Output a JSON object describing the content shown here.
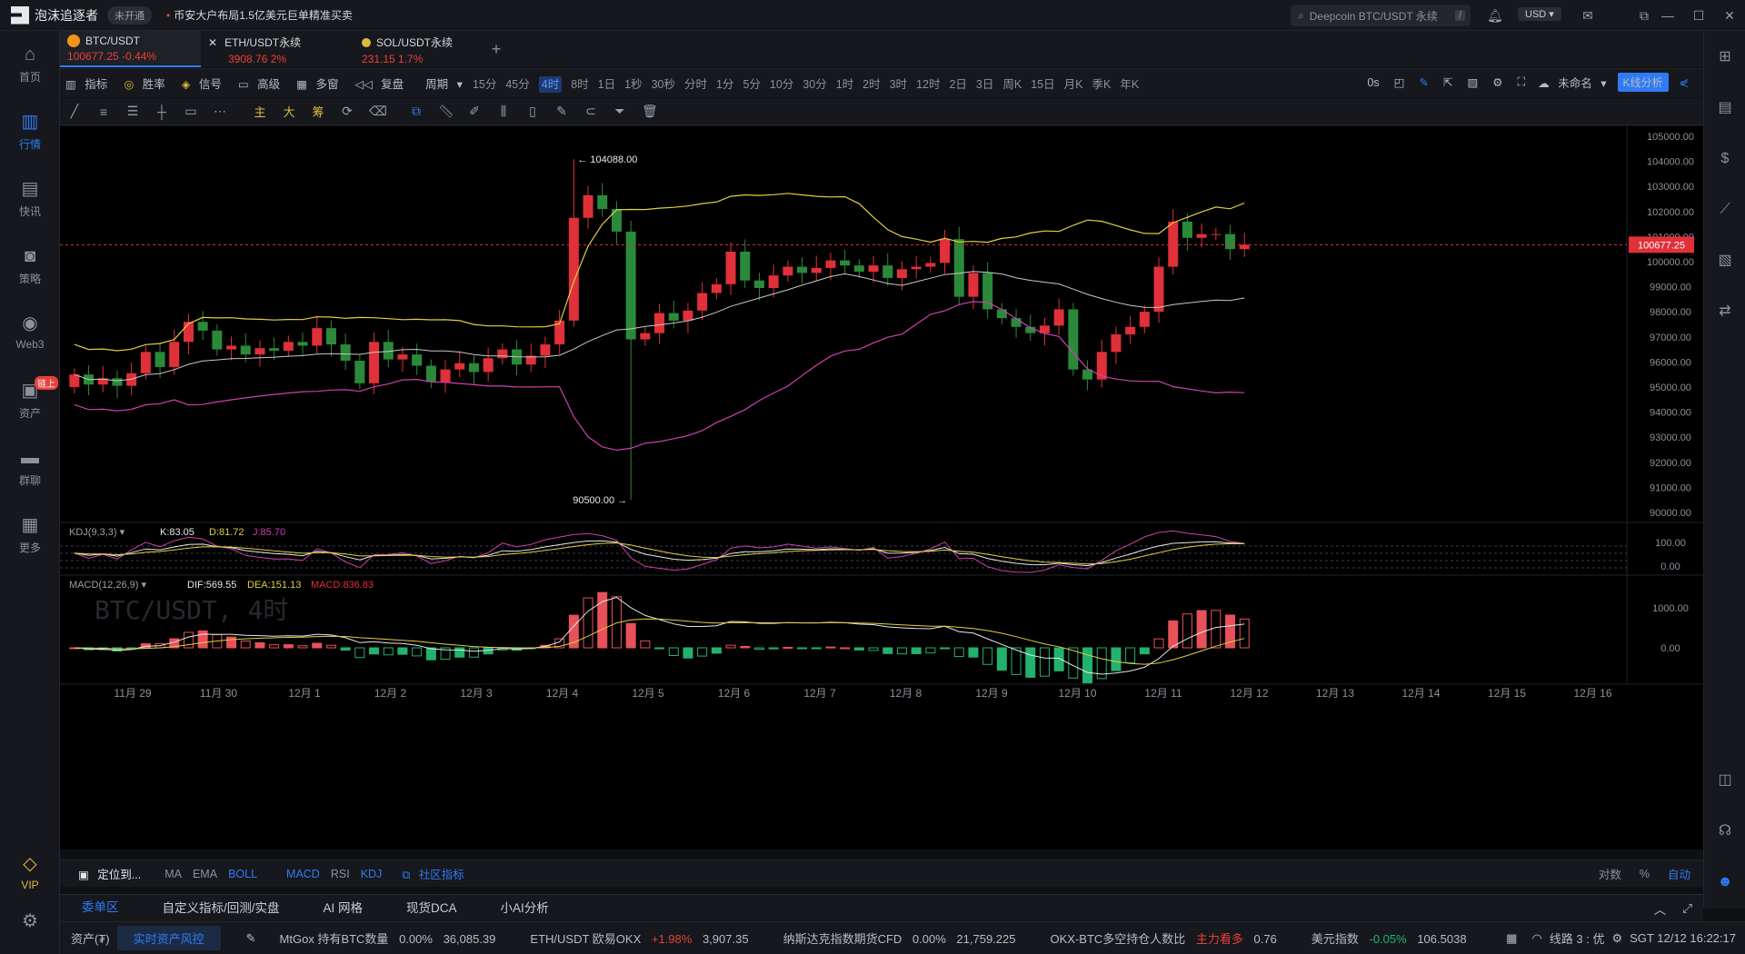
{
  "app": {
    "name": "泡沫追逐者",
    "badge": "未开通",
    "news": "币安大户布局1.5亿美元巨单精准买卖"
  },
  "search": {
    "placeholder": "Deepcoin BTC/USDT 永续",
    "shortcut": "/"
  },
  "currency": "USD",
  "sidebar": [
    {
      "label": "首页",
      "icon": "home-icon"
    },
    {
      "label": "行情",
      "icon": "chart-bars-icon",
      "active": true
    },
    {
      "label": "快讯",
      "icon": "news-icon"
    },
    {
      "label": "策略",
      "icon": "robot-icon"
    },
    {
      "label": "Web3",
      "icon": "web3-icon"
    },
    {
      "label": "资产",
      "icon": "wallet-icon",
      "tag": "链上"
    },
    {
      "label": "群聊",
      "icon": "chat-icon"
    },
    {
      "label": "更多",
      "icon": "grid-icon"
    },
    {
      "label": "VIP",
      "icon": "diamond-icon"
    }
  ],
  "tabs": [
    {
      "symbol": "BTC/USDT",
      "price": "100677.25",
      "change": "-0.44%",
      "color": "#f7931a"
    },
    {
      "symbol": "ETH/USDT永续",
      "price": "3908.76",
      "change": "2%",
      "color": "#627eea"
    },
    {
      "symbol": "SOL/USDT永续",
      "price": "231.15",
      "change": "1.7%",
      "color": "#e0b83a"
    }
  ],
  "toolbar": {
    "items": [
      "指标",
      "胜率",
      "信号",
      "高级",
      "多窗",
      "复盘",
      "周期"
    ],
    "periods": [
      "15分",
      "45分",
      "4时",
      "8时",
      "1日",
      "1秒",
      "30秒",
      "分时",
      "1分",
      "5分",
      "10分",
      "30分",
      "1时",
      "2时",
      "3时",
      "12时",
      "2日",
      "3日",
      "周K",
      "15日",
      "月K",
      "季K",
      "年K"
    ],
    "selected_period": "4时",
    "countdown": "0s",
    "layout_name": "未命名",
    "kline_analysis": "K线分析"
  },
  "drawtools": {
    "text_tools": [
      "主",
      "大",
      "筹"
    ]
  },
  "chart_data": {
    "type": "candlestick",
    "title": "BTC/USDT, 4时",
    "last_price": "100677.25",
    "high_label": "104088.00",
    "low_label": "90500.00",
    "ylim": [
      89600,
      105400
    ],
    "y_ticks": [
      "105000.00",
      "104000.00",
      "103000.00",
      "102000.00",
      "101000.00",
      "100000.00",
      "99000.00",
      "98000.00",
      "97000.00",
      "96000.00",
      "95000.00",
      "94000.00",
      "93000.00",
      "92000.00",
      "91000.00",
      "90000.00"
    ],
    "x_ticks": [
      "11月 29",
      "11月 30",
      "12月 1",
      "12月 2",
      "12月 3",
      "12月 4",
      "12月 5",
      "12月 6",
      "12月 7",
      "12月 8",
      "12月 9",
      "12月 10",
      "12月 11",
      "12月 12",
      "12月 13",
      "12月 14",
      "12月 15",
      "12月 16"
    ],
    "close": [
      95500,
      95100,
      95350,
      95050,
      95550,
      96400,
      95800,
      96800,
      97600,
      97250,
      96500,
      96650,
      96300,
      96550,
      96450,
      96800,
      96650,
      97350,
      96700,
      96050,
      95150,
      96800,
      96100,
      96300,
      95850,
      95200,
      95700,
      95950,
      95600,
      96150,
      96500,
      95900,
      96250,
      96700,
      97650,
      101750,
      102650,
      102100,
      101200,
      96900,
      97150,
      97950,
      97650,
      98050,
      98750,
      99100,
      100400,
      99250,
      98950,
      99450,
      99800,
      99550,
      99750,
      100050,
      99850,
      99600,
      99850,
      99350,
      99700,
      99800,
      99950,
      100900,
      98600,
      99550,
      98100,
      97750,
      97400,
      97150,
      97450,
      98100,
      95700,
      95300,
      96400,
      97100,
      97400,
      98000,
      99800,
      101600,
      100950,
      101100,
      101100,
      100500,
      100677
    ],
    "kdj": {
      "label": "KDJ(9,3,3)",
      "K": "K:83.05",
      "D": "D:81.72",
      "J": "J:85.70",
      "ticks": [
        "100.00",
        "0.00"
      ]
    },
    "macd": {
      "label": "MACD(12,26,9)",
      "DIF": "DIF:569.55",
      "DEA": "DEA:151.13",
      "MACD": "MACD:836.83",
      "ticks": [
        "1000.00",
        "0.00"
      ]
    },
    "boll": {
      "upper_color": "#e0d040",
      "mid_color": "#c8c8c8",
      "lower_color": "#d040b0"
    },
    "colors": {
      "up": "#e0303a",
      "down": "#2a8a3a"
    }
  },
  "indicators": {
    "locate": "定位到...",
    "main": [
      "MA",
      "EMA",
      "BOLL"
    ],
    "sub": [
      "MACD",
      "RSI",
      "KDJ"
    ],
    "community": "社区指标",
    "right": [
      "对数",
      "%",
      "自动"
    ]
  },
  "bottom_tabs": [
    "委单区",
    "自定义指标/回测/实盘",
    "AI 网格",
    "现货DCA",
    "小AI分析"
  ],
  "status": {
    "assets": "资产(₮)",
    "risk": "实时资产风控",
    "items": [
      {
        "name": "MtGox 持有BTC数量",
        "chg": "0.00%",
        "val": "36,085.39"
      },
      {
        "name": "ETH/USDT 欧易OKX",
        "chg": "+1.98%",
        "val": "3,907.35"
      },
      {
        "name": "纳斯达克指数期货CFD",
        "chg": "0.00%",
        "val": "21,759.225"
      },
      {
        "name": "OKX-BTC多空持仓人数比",
        "chg": "主力看多",
        "val": "0.76"
      },
      {
        "name": "美元指数",
        "chg": "-0.05%",
        "val": "106.5038"
      }
    ],
    "line": "线路 3 : 优",
    "time": "SGT  12/12 16:22:17"
  }
}
